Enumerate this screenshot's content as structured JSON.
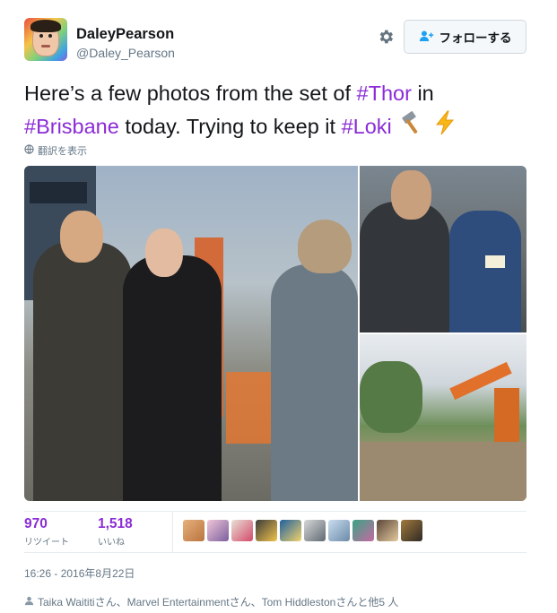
{
  "header": {
    "display_name": "DaleyPearson",
    "screen_name": "@Daley_Pearson",
    "follow_label": "フォローする"
  },
  "tweet": {
    "segments": [
      {
        "text": "Here’s a few photos from the set of ",
        "hashtag": false
      },
      {
        "text": "#Thor",
        "hashtag": true
      },
      {
        "text": " in ",
        "hashtag": false
      },
      {
        "text": "#Brisbane",
        "hashtag": true
      },
      {
        "text": " today. Trying to keep it ",
        "hashtag": false
      },
      {
        "text": "#Loki",
        "hashtag": true
      }
    ],
    "emoji": [
      "hammer",
      "lightning"
    ],
    "hashtag_color": "#8b2cd6",
    "translate_label": "翻訳を表示"
  },
  "media": {
    "count": 3
  },
  "stats": {
    "retweets": {
      "count": "970",
      "label": "リツイート"
    },
    "likes": {
      "count": "1,518",
      "label": "いいね"
    },
    "liker_avatars": 9,
    "accent_color": "#8b2cd6"
  },
  "timestamp": "16:26 - 2016年8月22日",
  "mentions_text": "Taika Waititiさん、Marvel Entertainmentさん、Tom Hiddlestonさんと他5 人"
}
